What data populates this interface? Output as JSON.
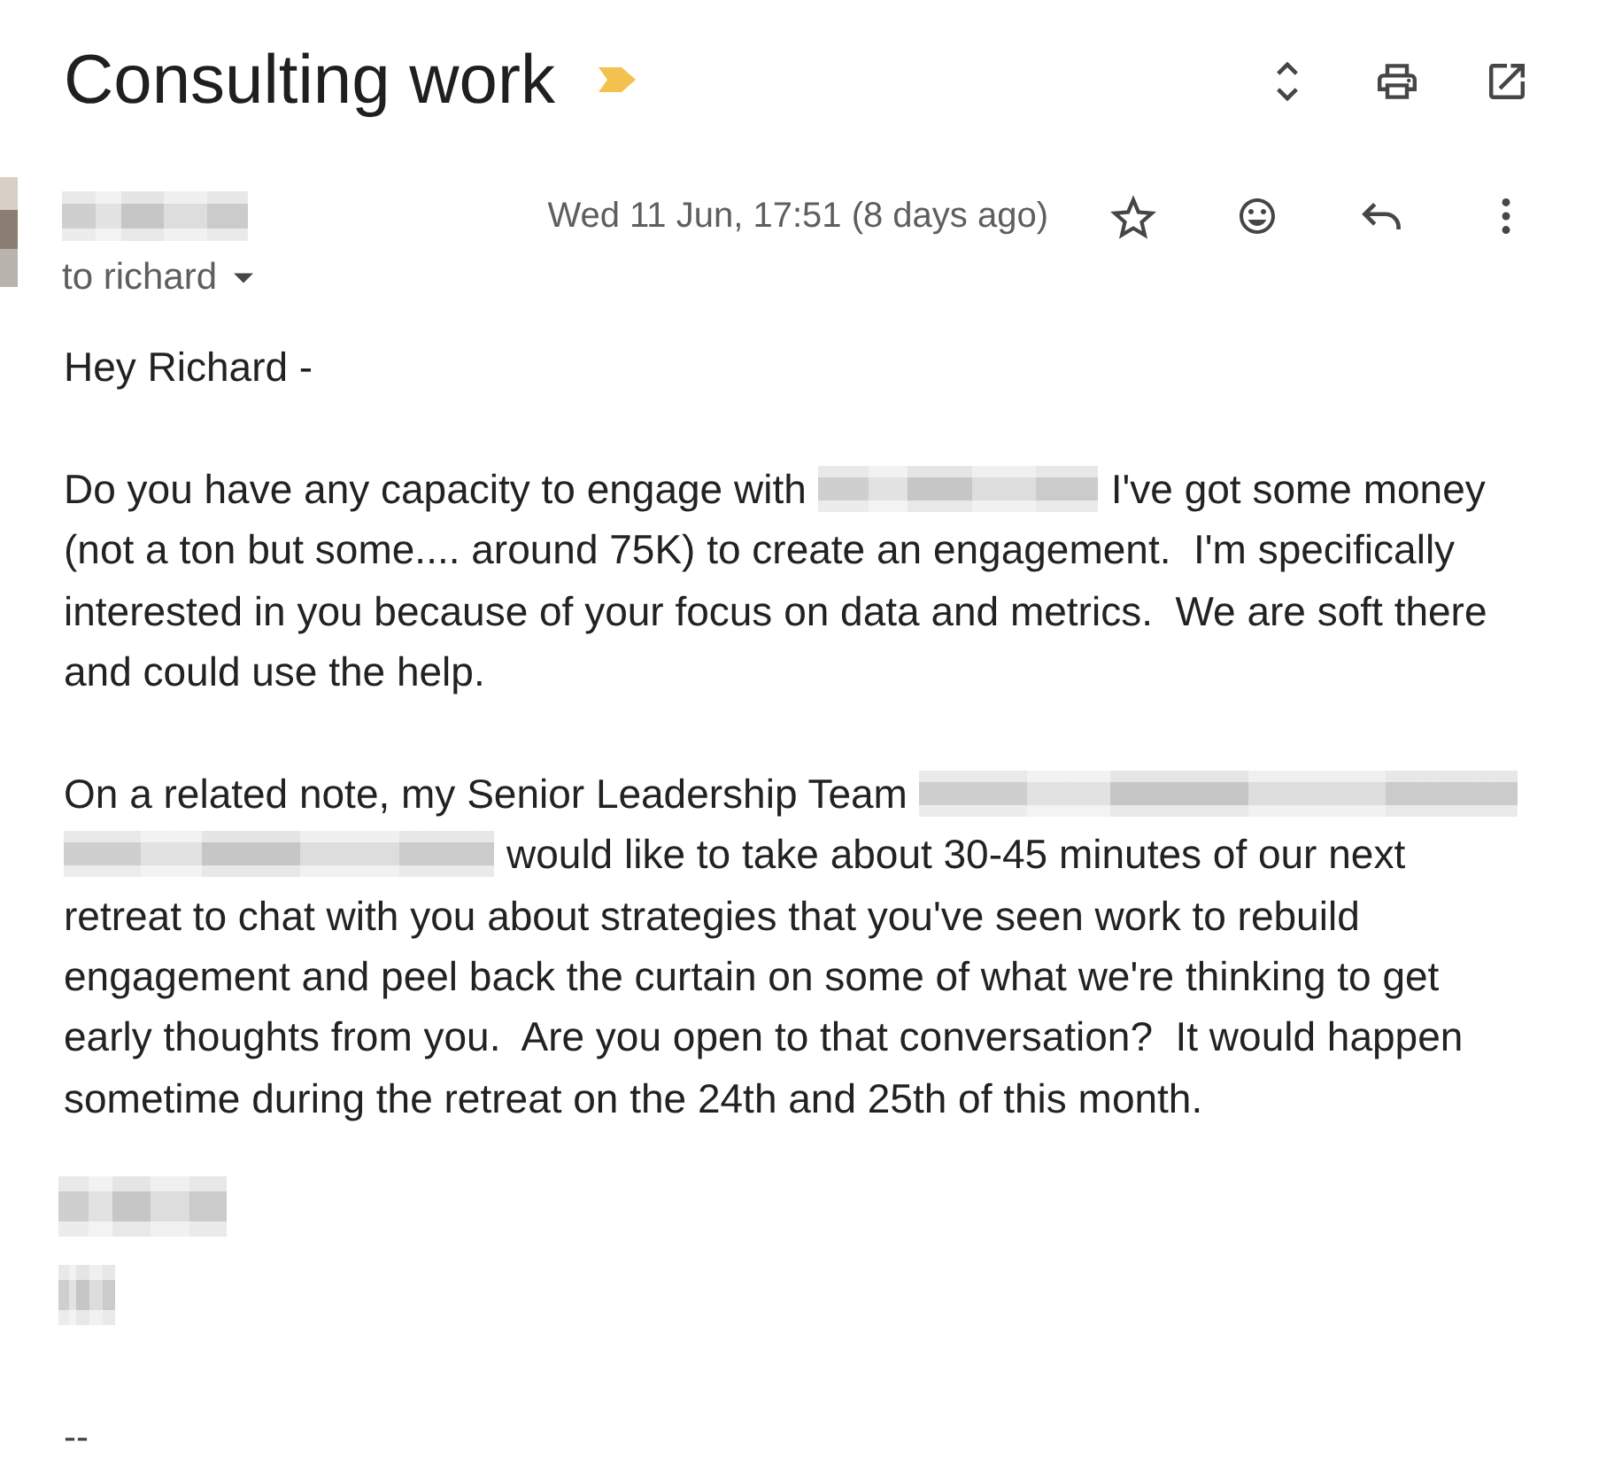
{
  "subject": {
    "title": "Consulting work",
    "important": true
  },
  "header": {
    "date": "Wed 11 Jun, 17:51 (8 days ago)",
    "starred": false,
    "recipients": "to richard"
  },
  "body": {
    "greeting": "Hey Richard -",
    "paragraphs": [
      {
        "lines": [
          {
            "segments": [
              {
                "kind": "text",
                "text": "Do you have any capacity to engage with"
              },
              {
                "kind": "redacted"
              },
              {
                "kind": "text",
                "text": "I've got some money"
              }
            ]
          },
          {
            "segments": [
              {
                "kind": "text",
                "text": "(not a ton but some.... around 75K) to create an engagement.  I'm specifically"
              }
            ]
          },
          {
            "segments": [
              {
                "kind": "text",
                "text": "interested in you because of your focus on data and metrics.  We are soft there"
              }
            ]
          },
          {
            "segments": [
              {
                "kind": "text",
                "text": "and could use the help."
              }
            ]
          }
        ]
      },
      {
        "lines": [
          {
            "segments": [
              {
                "kind": "text",
                "text": "On a related note, my Senior Leadership Team"
              },
              {
                "kind": "redacted"
              }
            ]
          },
          {
            "segments": [
              {
                "kind": "redacted"
              },
              {
                "kind": "text",
                "text": "would like to take about 30-45 minutes of our next"
              }
            ]
          },
          {
            "segments": [
              {
                "kind": "text",
                "text": "retreat to chat with you about strategies that you've seen work to rebuild"
              }
            ]
          },
          {
            "segments": [
              {
                "kind": "text",
                "text": "engagement and peel back the curtain on some of what we're thinking to get"
              }
            ]
          },
          {
            "segments": [
              {
                "kind": "text",
                "text": "early thoughts from you.  Are you open to that conversation?  It would happen"
              }
            ]
          },
          {
            "segments": [
              {
                "kind": "text",
                "text": "sometime during the retreat on the 24th and 25th of this month."
              }
            ]
          }
        ]
      }
    ],
    "separator": "--"
  }
}
